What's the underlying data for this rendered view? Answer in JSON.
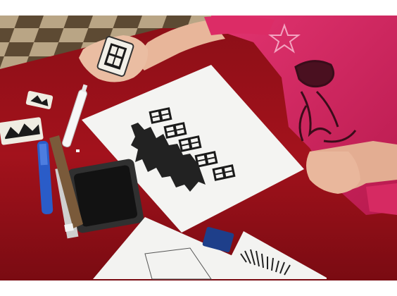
{
  "scene": {
    "colors": {
      "floor_light": "#c9b89a",
      "floor_dark": "#5d4a33",
      "table_red": "#a3121c",
      "table_red_dark": "#6f0a10",
      "paper": "#f4f4f2",
      "ink": "#1a1a1a",
      "shirt": "#d8245f",
      "skin": "#e8b69a",
      "ink_pad": "#1e1e1e",
      "marker_blue": "#2a5cc8"
    }
  }
}
